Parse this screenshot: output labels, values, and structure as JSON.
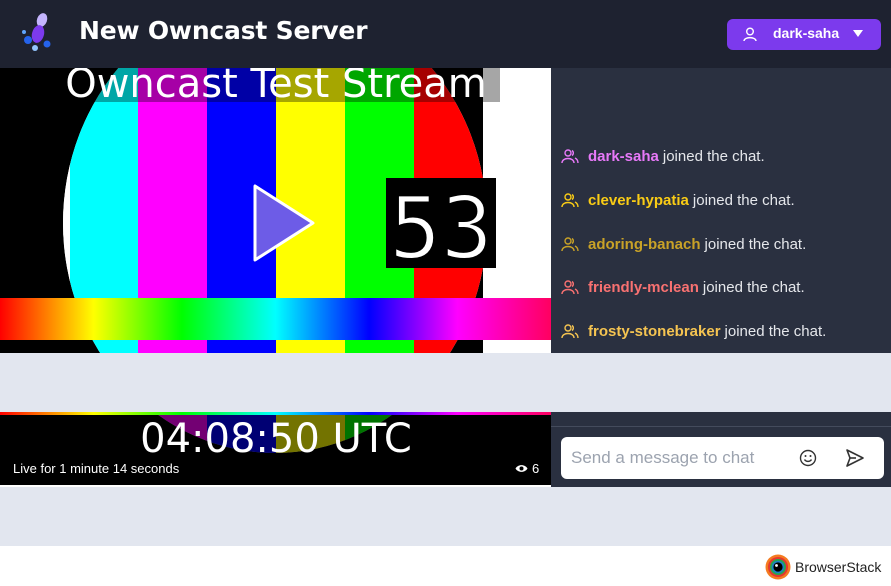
{
  "header": {
    "title": "New Owncast Server",
    "user_button": {
      "username": "dark-saha",
      "icon": "user-icon",
      "menu_icon": "caret-down-icon"
    },
    "logo_icon": "owncast-logo-icon"
  },
  "video": {
    "overlay_title": "Owncast Test Stream",
    "clock_text": "04:08:50 UTC",
    "counter_text": "53",
    "play_icon": "play-icon",
    "live_status": "Live for 1 minute 14 seconds",
    "viewer_count": "6",
    "viewer_icon": "eye-icon"
  },
  "chat": {
    "messages": [
      {
        "username": "dark-saha",
        "text": "joined the chat.",
        "color": "#e879f9"
      },
      {
        "username": "clever-hypatia",
        "text": "joined the chat.",
        "color": "#facc15"
      },
      {
        "username": "adoring-banach",
        "text": "joined the chat.",
        "color": "#c9a227"
      },
      {
        "username": "friendly-mclean",
        "text": "joined the chat.",
        "color": "#f87171"
      },
      {
        "username": "frosty-stonebraker",
        "text": "joined the chat.",
        "color": "#f5c451"
      }
    ],
    "input_placeholder": "Send a message to chat",
    "emoji_icon": "emoji-icon",
    "send_icon": "send-icon"
  },
  "footer": {
    "browserstack_label": "BrowserStack"
  },
  "colors": {
    "header_bg": "#1e2230",
    "accent": "#7c3aed",
    "chat_bg": "#2a3040",
    "page_bg": "#e2e6ef"
  }
}
